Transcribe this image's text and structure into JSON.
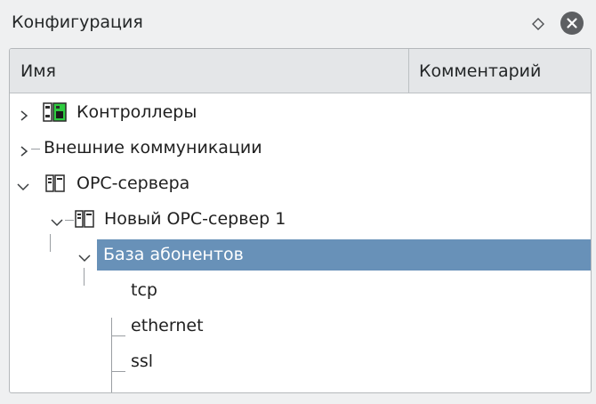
{
  "window": {
    "title": "Конфигурация"
  },
  "columns": {
    "name": "Имя",
    "comment": "Комментарий"
  },
  "tree": {
    "controllers": "Контроллеры",
    "external": "Внешние коммуникации",
    "opc_servers": "OPC-сервера",
    "new_opc_server": "Новый OPC-сервер 1",
    "subscribers_db": "База абонентов",
    "tcp": "tcp",
    "ethernet": "ethernet",
    "ssl": "ssl"
  },
  "colors": {
    "selection": "#6891b8",
    "panel_bg": "#ffffff",
    "window_bg": "#eff0f1"
  },
  "icons": [
    "float-icon",
    "close-icon",
    "controller-icon",
    "server-icon",
    "chevron-right-icon",
    "chevron-down-icon"
  ]
}
